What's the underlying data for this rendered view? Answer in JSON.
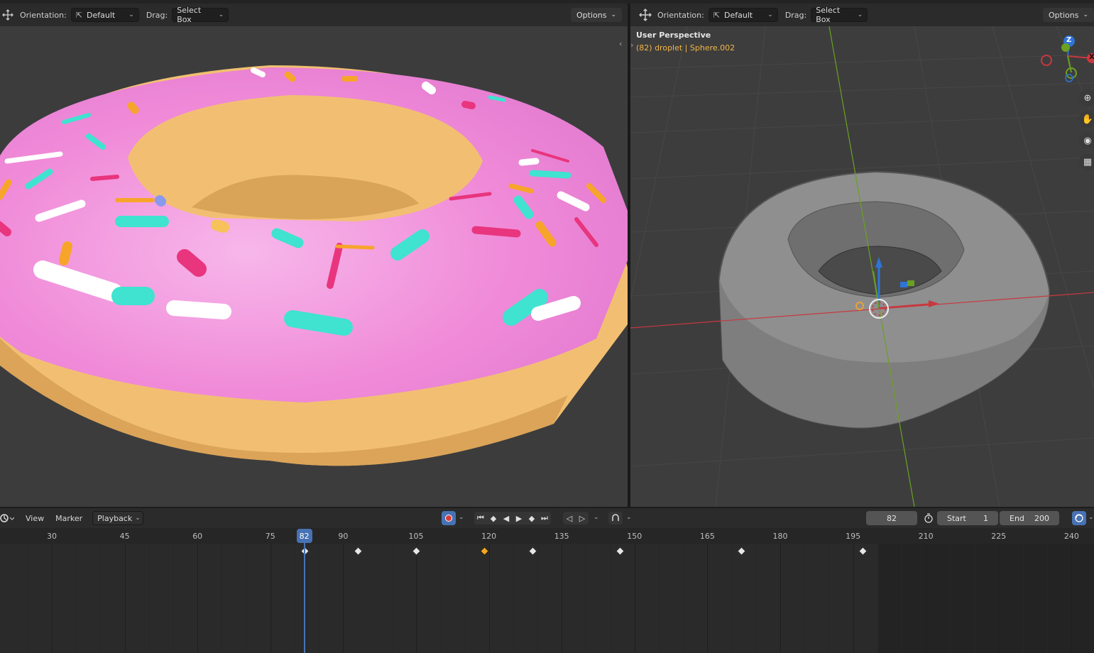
{
  "left_viewport": {
    "orientation_label": "Orientation:",
    "orientation_value": "Default",
    "drag_label": "Drag:",
    "drag_value": "Select Box",
    "options_label": "Options"
  },
  "right_viewport": {
    "orientation_label": "Orientation:",
    "orientation_value": "Default",
    "drag_label": "Drag:",
    "drag_value": "Select Box",
    "options_label": "Options",
    "view_name": "User Perspective",
    "object_info": "(82) droplet | Sphere.002",
    "gizmo_z": "Z",
    "gizmo_x": "X"
  },
  "timeline": {
    "menu": [
      "View",
      "Marker",
      "Playback"
    ],
    "current_frame": "82",
    "start_label": "Start",
    "start_value": "1",
    "end_label": "End",
    "end_value": "200",
    "ruler_ticks": [
      "30",
      "45",
      "60",
      "75",
      "90",
      "105",
      "120",
      "135",
      "150",
      "165",
      "180",
      "195",
      "210",
      "225",
      "240"
    ],
    "keyframes": [
      82,
      93,
      105,
      119,
      129,
      147,
      172,
      197
    ],
    "selected_keyframe": 119,
    "playhead_frame": 82
  },
  "colors": {
    "accent": "#4772b3",
    "frosting": "#f08ad8",
    "dough": "#f2bf72",
    "x_axis": "#c9383f",
    "y_axis": "#6aa123",
    "z_axis": "#2f74d6",
    "keyframe_selected": "#f5a623"
  }
}
